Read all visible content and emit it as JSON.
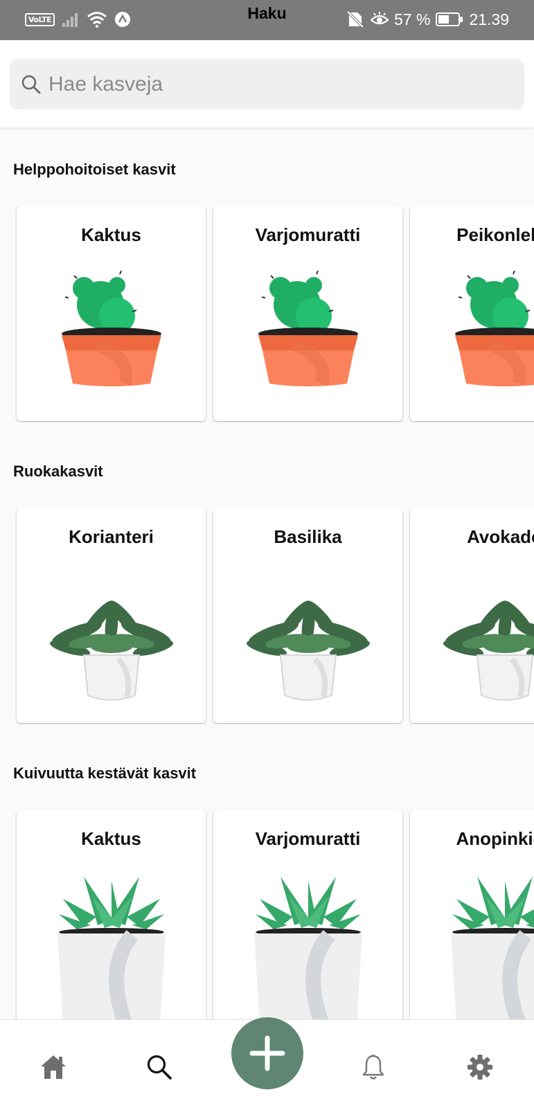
{
  "status_bar": {
    "volte": "VoLTE",
    "title": "Haku",
    "battery_percent": "57 %",
    "time": "21.39"
  },
  "search": {
    "placeholder": "Hae kasveja",
    "value": ""
  },
  "sections": [
    {
      "title": "Helppohoitoiset kasvit",
      "cards": [
        {
          "label": "Kaktus",
          "image": "cactus-pot"
        },
        {
          "label": "Varjomuratti",
          "image": "cactus-pot"
        },
        {
          "label": "Peikonlehti",
          "image": "cactus-pot"
        }
      ]
    },
    {
      "title": "Ruokakasvit",
      "cards": [
        {
          "label": "Korianteri",
          "image": "leafy-plant-white-pot"
        },
        {
          "label": "Basilika",
          "image": "leafy-plant-white-pot"
        },
        {
          "label": "Avokado",
          "image": "leafy-plant-white-pot"
        }
      ]
    },
    {
      "title": "Kuivuutta kestävät kasvit",
      "cards": [
        {
          "label": "Kaktus",
          "image": "succulent-white-pot"
        },
        {
          "label": "Varjomuratti",
          "image": "succulent-white-pot"
        },
        {
          "label": "Anopinkieli",
          "image": "succulent-white-pot"
        }
      ]
    }
  ],
  "bottom_nav": {
    "items": [
      {
        "icon": "home-icon"
      },
      {
        "icon": "search-icon"
      },
      {
        "icon": "plus-icon"
      },
      {
        "icon": "bell-icon"
      },
      {
        "icon": "gear-icon"
      }
    ],
    "fab_color": "#5e8672"
  },
  "colors": {
    "status_bar": "#7b7b7b",
    "cactus_green": "#1fae63",
    "terracotta": "#f47a50"
  }
}
